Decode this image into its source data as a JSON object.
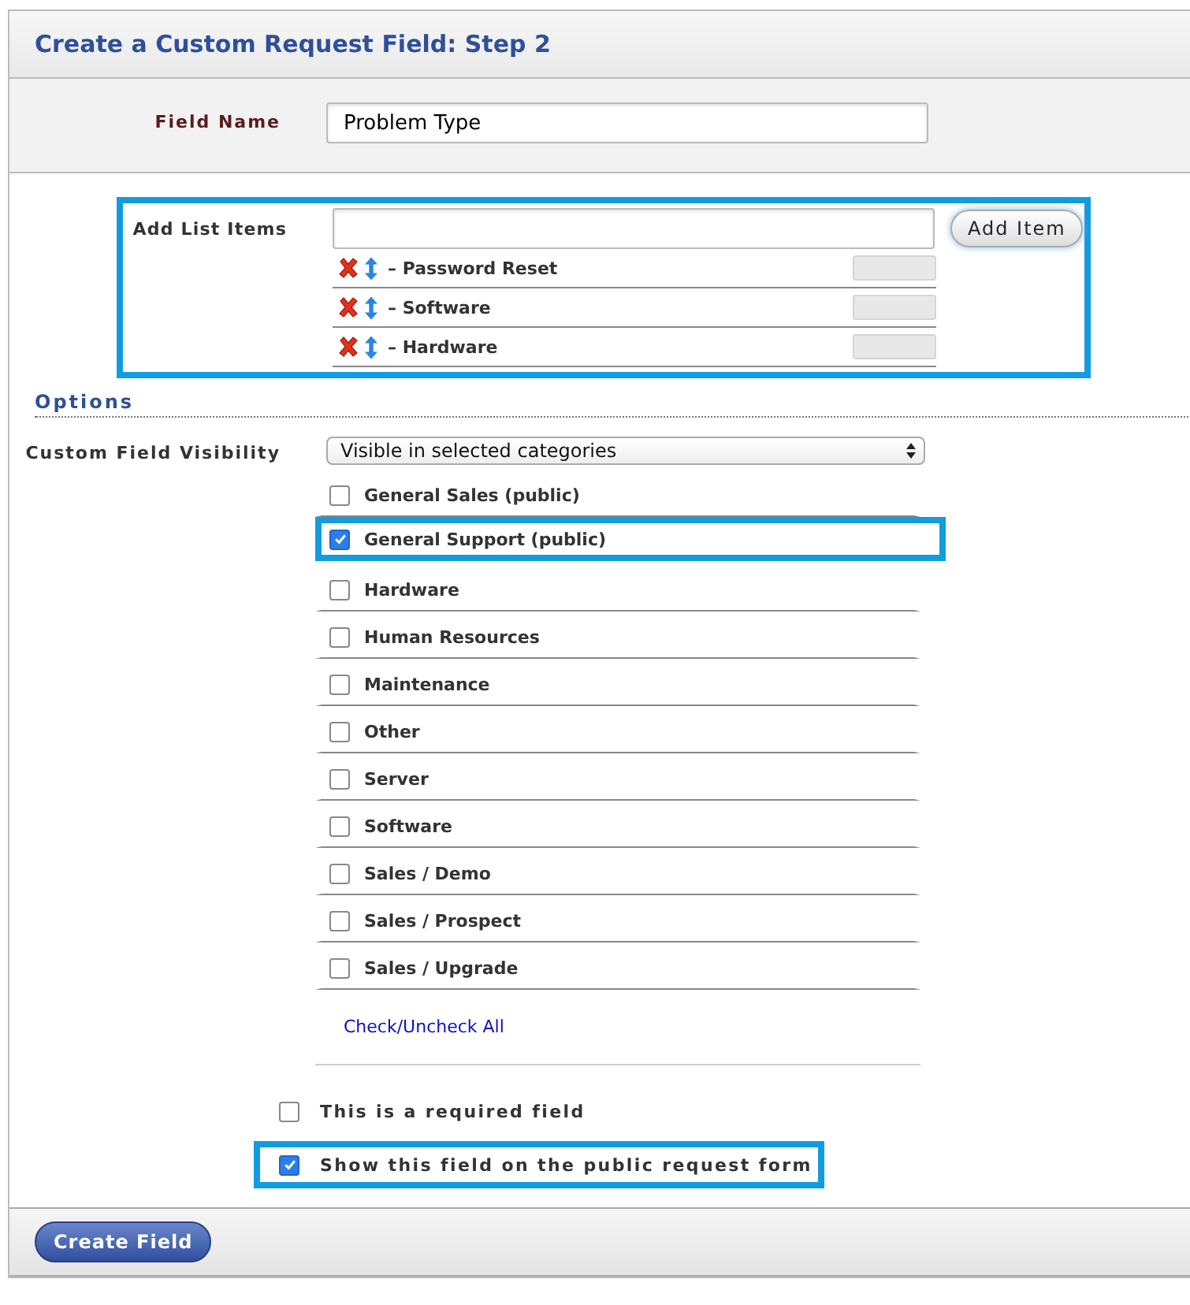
{
  "title": "Create a Custom Request Field: Step 2",
  "field_name": {
    "label": "Field Name",
    "value": "Problem Type"
  },
  "list_items": {
    "label": "Add List Items",
    "highlighted": true,
    "button": "Add Item",
    "items": [
      {
        "label": "– Password Reset"
      },
      {
        "label": "– Software"
      },
      {
        "label": "– Hardware"
      }
    ]
  },
  "options": {
    "heading": "Options",
    "visibility": {
      "label": "Custom Field Visibility",
      "value": "Visible in selected categories"
    },
    "categories": [
      {
        "label": "General Sales (public)",
        "checked": false,
        "highlighted": false
      },
      {
        "label": "General Support (public)",
        "checked": true,
        "highlighted": true
      },
      {
        "label": "Hardware",
        "checked": false,
        "highlighted": false
      },
      {
        "label": "Human Resources",
        "checked": false,
        "highlighted": false
      },
      {
        "label": "Maintenance",
        "checked": false,
        "highlighted": false
      },
      {
        "label": "Other",
        "checked": false,
        "highlighted": false
      },
      {
        "label": "Server",
        "checked": false,
        "highlighted": false
      },
      {
        "label": "Software",
        "checked": false,
        "highlighted": false
      },
      {
        "label": "Sales / Demo",
        "checked": false,
        "highlighted": false
      },
      {
        "label": "Sales / Prospect",
        "checked": false,
        "highlighted": false
      },
      {
        "label": "Sales / Upgrade",
        "checked": false,
        "highlighted": false
      }
    ],
    "check_all": "Check/Uncheck All",
    "flags": [
      {
        "label": "This is a required field",
        "checked": false,
        "highlighted": false
      },
      {
        "label": "Show this field on the public request form",
        "checked": true,
        "highlighted": true
      }
    ]
  },
  "submit": "Create Field"
}
